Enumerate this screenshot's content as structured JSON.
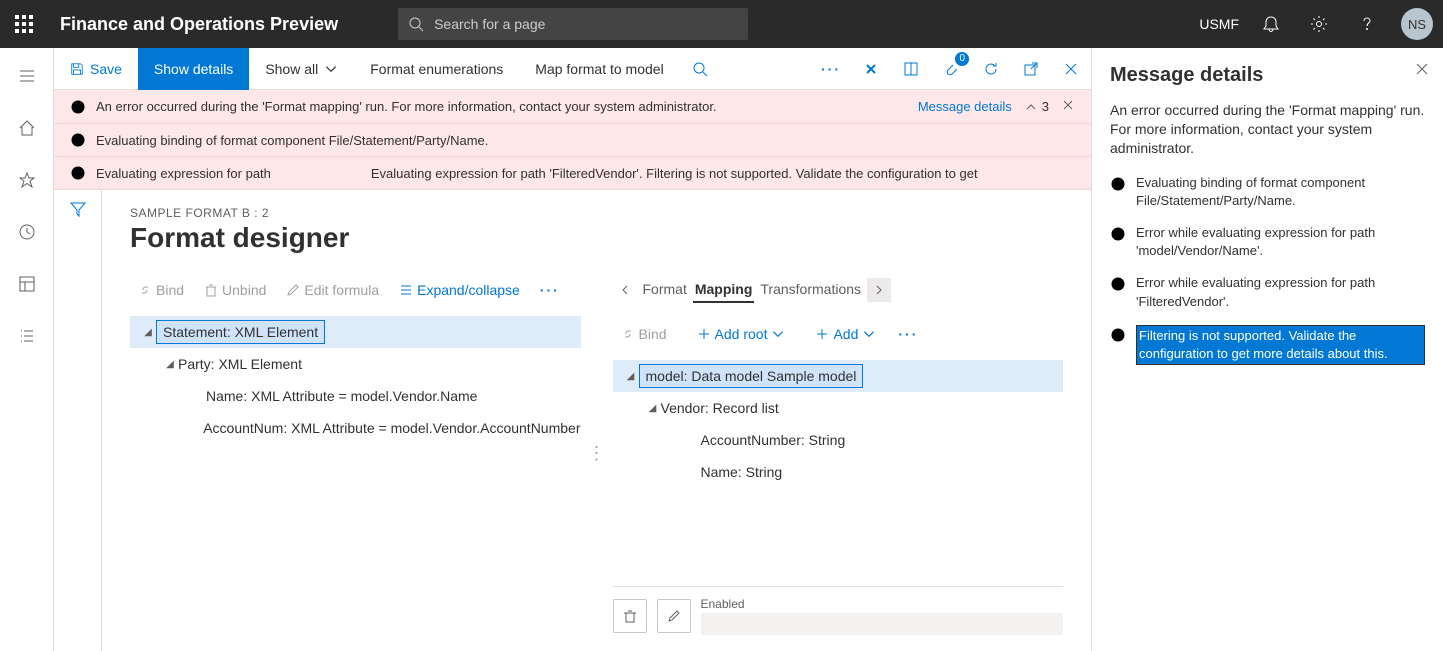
{
  "header": {
    "app_title": "Finance and Operations Preview",
    "search_placeholder": "Search for a page",
    "company": "USMF",
    "avatar": "NS"
  },
  "action_bar": {
    "save": "Save",
    "show_details": "Show details",
    "show_all": "Show all",
    "format_enum": "Format enumerations",
    "map_format": "Map format to model",
    "attach_badge": "0"
  },
  "banners": [
    {
      "text": "An error occurred during the 'Format mapping' run. For more information, contact your system administrator.",
      "link": "Message details",
      "count": "3"
    },
    {
      "text": "Evaluating binding of format component File/Statement/Party/Name."
    },
    {
      "text": "Evaluating expression for path",
      "extra": "Evaluating expression for path 'FilteredVendor'. Filtering is not supported. Validate the configuration to get"
    }
  ],
  "designer": {
    "breadcrumb": "SAMPLE FORMAT B : 2",
    "title": "Format designer",
    "left_toolbar": {
      "bind": "Bind",
      "unbind": "Unbind",
      "edit": "Edit formula",
      "expand": "Expand/collapse"
    },
    "left_tree": [
      {
        "text": "Statement: XML Element",
        "level": 1,
        "caret": true,
        "selected": true
      },
      {
        "text": "Party: XML Element",
        "level": 2,
        "caret": true
      },
      {
        "text": "Name: XML Attribute = model.Vendor.Name",
        "level": 3
      },
      {
        "text": "AccountNum: XML Attribute = model.Vendor.AccountNumber",
        "level": 3
      }
    ],
    "right_tabs": {
      "format": "Format",
      "mapping": "Mapping",
      "transformations": "Transformations"
    },
    "right_toolbar": {
      "bind": "Bind",
      "add_root": "Add root",
      "add": "Add"
    },
    "right_tree": [
      {
        "text": "model: Data model Sample model",
        "level": 1,
        "caret": true,
        "selected": true
      },
      {
        "text": "Vendor: Record list",
        "level": 2,
        "caret": true
      },
      {
        "text": "AccountNumber: String",
        "level": 3
      },
      {
        "text": "Name: String",
        "level": 3
      }
    ],
    "bottom": {
      "enabled_label": "Enabled"
    }
  },
  "msg_panel": {
    "title": "Message details",
    "desc": "An error occurred during the 'Format mapping' run. For more information, contact your system administrator.",
    "items": [
      "Evaluating binding of format component File/Statement/Party/Name.",
      "Error while evaluating expression for path 'model/Vendor/Name'.",
      "Error while evaluating expression for path 'FilteredVendor'.",
      "Filtering is not supported. Validate the configuration to get more details about this."
    ]
  }
}
